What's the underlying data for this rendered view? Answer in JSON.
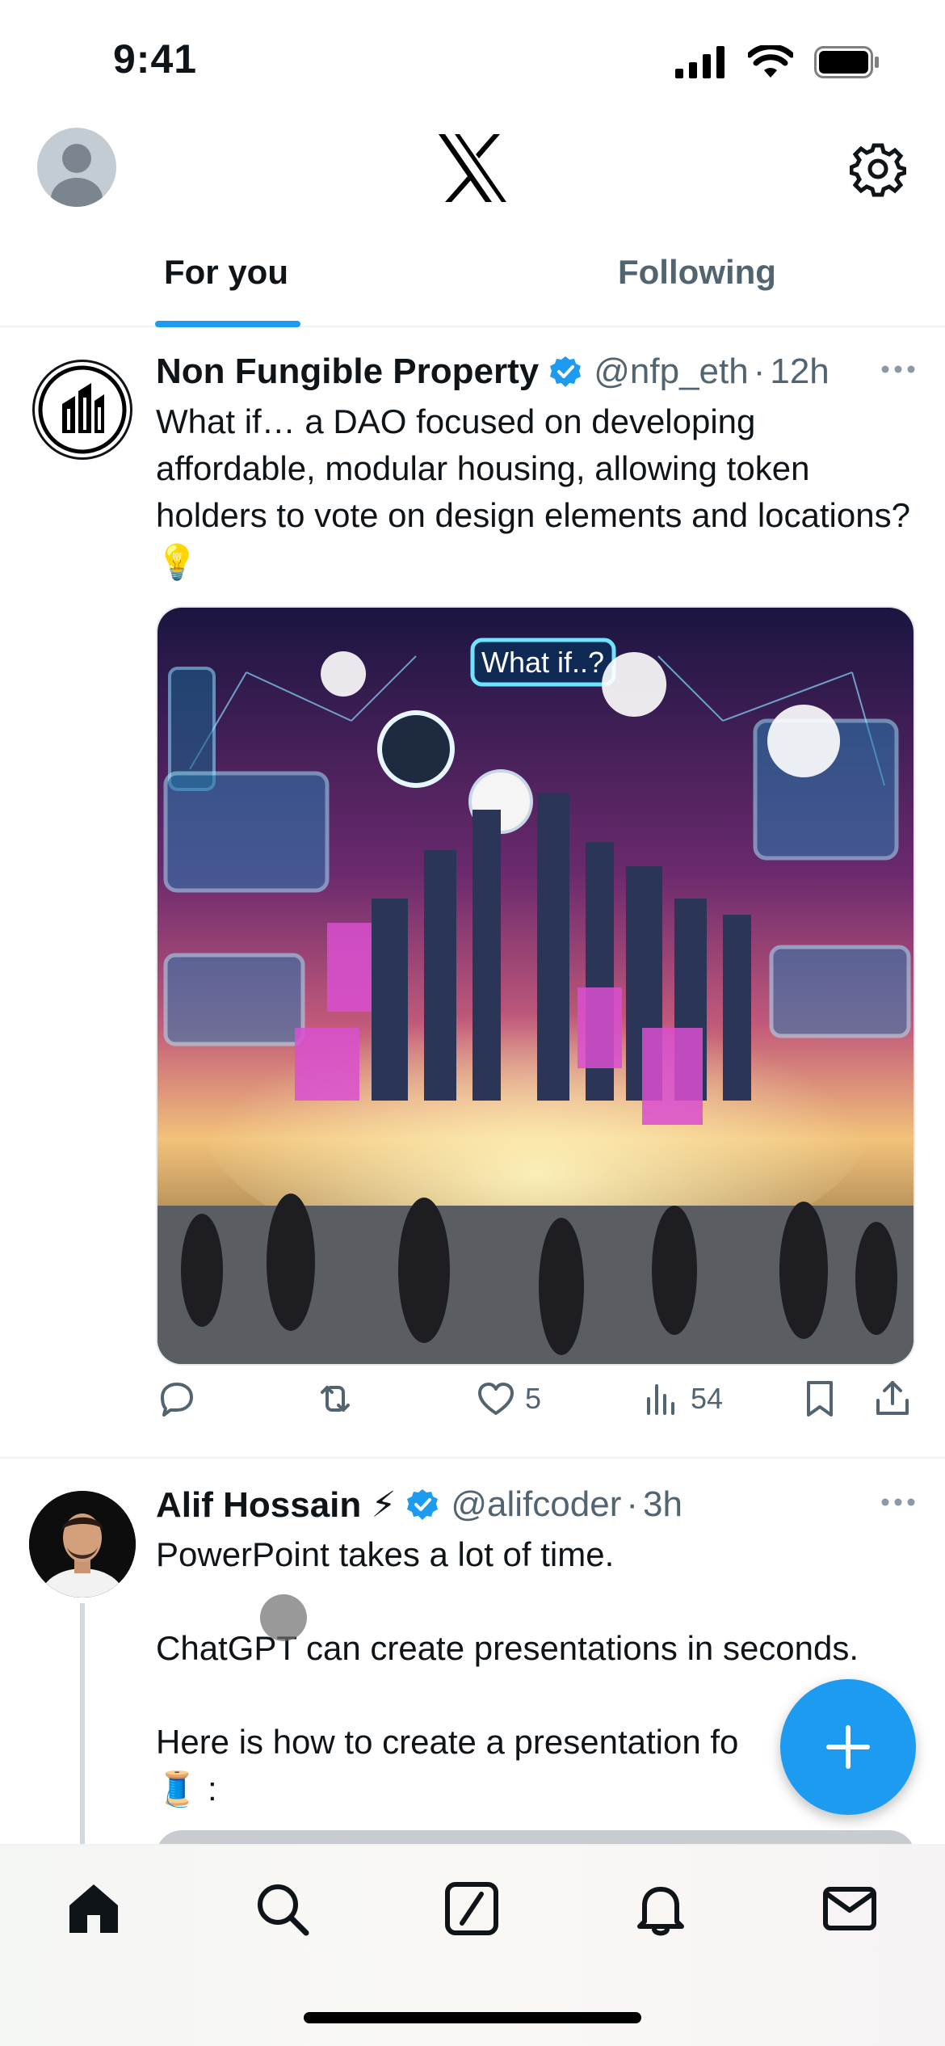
{
  "status_bar": {
    "time": "9:41"
  },
  "header": {
    "logo": "X",
    "settings_icon": "gear-icon"
  },
  "tabs": [
    {
      "label": "For you",
      "active": true
    },
    {
      "label": "Following",
      "active": false
    }
  ],
  "posts": [
    {
      "author": "Non Fungible Property",
      "verified": true,
      "handle": "@nfp_eth",
      "time": "12h",
      "text": "What if… a DAO focused on developing affordable, modular housing, allowing token holders to vote on design elements and locations? 💡",
      "media_caption": "What if..?",
      "actions": {
        "replies": "",
        "reposts": "",
        "likes": "5",
        "views": "54"
      }
    },
    {
      "author": "Alif Hossain ⚡",
      "verified": true,
      "handle": "@alifcoder",
      "time": "3h",
      "text": "PowerPoint takes a lot of time.\n\nChatGPT can create presentations in seconds.\n\nHere is how to create a presentation fo\n🧵 :"
    }
  ],
  "fab": {
    "icon": "plus-icon"
  },
  "tab_bar": {
    "items": [
      "home-icon",
      "search-icon",
      "grok-icon",
      "bell-icon",
      "mail-icon"
    ]
  },
  "colors": {
    "accent": "#1d9bf0",
    "text": "#0f1419",
    "muted": "#536471"
  }
}
